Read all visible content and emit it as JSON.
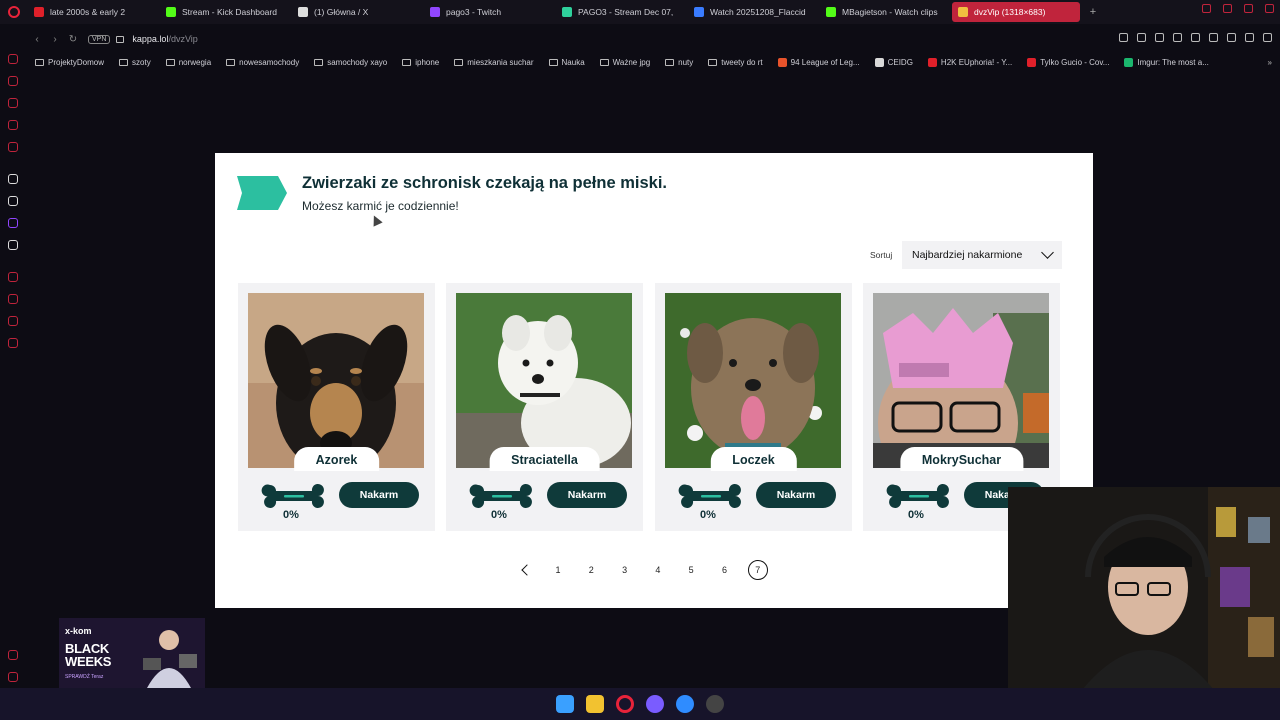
{
  "browser": {
    "tabs": [
      {
        "label": "late 2000s & early 2",
        "fav": "#e0202a"
      },
      {
        "label": "Stream - Kick Dashboard",
        "fav": "#53fc18"
      },
      {
        "label": "(1) Główna / X",
        "fav": "#dddddd"
      },
      {
        "label": "pago3 - Twitch",
        "fav": "#9146ff"
      },
      {
        "label": "PAGO3 - Stream Dec 07,",
        "fav": "#2fd19c"
      },
      {
        "label": "Watch 20251208_Flaccid",
        "fav": "#3a7cff"
      },
      {
        "label": "MBagietson - Watch clips",
        "fav": "#53fc18"
      },
      {
        "label": "dvzVip (1318×683)",
        "fav": "#f0c040",
        "active": true
      }
    ],
    "new_tab_label": "+",
    "vpn_label": "VPN",
    "url": {
      "host": "kappa.lol",
      "path": "/dvzVip"
    },
    "bookmarks": [
      {
        "label": "ProjektyDomow",
        "type": "folder"
      },
      {
        "label": "szoty",
        "type": "folder"
      },
      {
        "label": "norwegia",
        "type": "folder"
      },
      {
        "label": "nowesamochody",
        "type": "folder"
      },
      {
        "label": "samochody xayo",
        "type": "folder"
      },
      {
        "label": "iphone",
        "type": "folder"
      },
      {
        "label": "mieszkania suchar",
        "type": "folder"
      },
      {
        "label": "Nauka",
        "type": "folder"
      },
      {
        "label": "Ważne jpg",
        "type": "folder"
      },
      {
        "label": "nuty",
        "type": "folder"
      },
      {
        "label": "tweety do rt",
        "type": "folder"
      },
      {
        "label": "94 League of Leg...",
        "type": "site",
        "color": "#e8532b"
      },
      {
        "label": "CEIDG",
        "type": "site",
        "color": "#d9d9d9"
      },
      {
        "label": "H2K EUphoria! - Y...",
        "type": "site",
        "color": "#e0202a"
      },
      {
        "label": "Tylko Gucio - Cov...",
        "type": "site",
        "color": "#e0202a"
      },
      {
        "label": "Imgur: The most a...",
        "type": "site",
        "color": "#1bb76e"
      }
    ],
    "bookmarks_more": "»"
  },
  "page": {
    "title": "Zwierzaki ze schronisk czekają na pełne miski.",
    "subtitle": "Możesz karmić je codziennie!",
    "sort": {
      "label": "Sortuj",
      "value": "Najbardziej nakarmione"
    },
    "animals": [
      {
        "name": "Azorek",
        "percent": "0%",
        "button": "Nakarm"
      },
      {
        "name": "Straciatella",
        "percent": "0%",
        "button": "Nakarm"
      },
      {
        "name": "Loczek",
        "percent": "0%",
        "button": "Nakarm"
      },
      {
        "name": "MokrySuchar",
        "percent": "0%",
        "button": "Nakarm"
      }
    ],
    "pagination": {
      "pages": [
        "1",
        "2",
        "3",
        "4",
        "5",
        "6",
        "7"
      ],
      "current": "7"
    },
    "colors": {
      "accent": "#2cbfa0",
      "dark": "#0f3a3a",
      "title": "#0f3036"
    }
  },
  "ad": {
    "logo": "x-kom",
    "title_line1": "BLACK",
    "title_line2": "WEEKS",
    "sub": "SPRAWDŹ Teraz"
  }
}
